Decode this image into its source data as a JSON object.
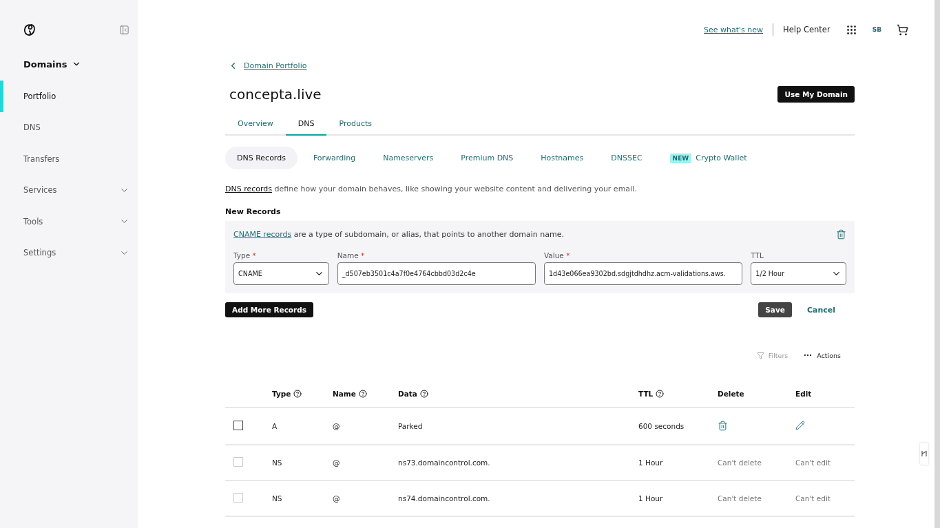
{
  "sidebar": {
    "section": "Domains",
    "items": [
      {
        "label": "Portfolio",
        "selected": true,
        "expandable": false
      },
      {
        "label": "DNS",
        "selected": false,
        "expandable": false
      },
      {
        "label": "Transfers",
        "selected": false,
        "expandable": false
      },
      {
        "label": "Services",
        "selected": false,
        "expandable": true
      },
      {
        "label": "Tools",
        "selected": false,
        "expandable": true
      },
      {
        "label": "Settings",
        "selected": false,
        "expandable": true
      }
    ]
  },
  "header": {
    "whats_new": "See what's new",
    "help": "Help Center",
    "avatar": "SB"
  },
  "breadcrumb": "Domain Portfolio",
  "title": "concepta.live",
  "primary_button": "Use My Domain",
  "tabs": [
    {
      "label": "Overview",
      "selected": false
    },
    {
      "label": "DNS",
      "selected": true
    },
    {
      "label": "Products",
      "selected": false
    }
  ],
  "subtabs": [
    {
      "label": "DNS Records",
      "selected": true
    },
    {
      "label": "Forwarding",
      "selected": false
    },
    {
      "label": "Nameservers",
      "selected": false
    },
    {
      "label": "Premium DNS",
      "selected": false
    },
    {
      "label": "Hostnames",
      "selected": false
    },
    {
      "label": "DNSSEC",
      "selected": false
    },
    {
      "label": "Crypto Wallet",
      "selected": false,
      "badge": "NEW"
    }
  ],
  "description": {
    "link": "DNS records",
    "text": " define how your domain behaves, like showing your website content and delivering your email."
  },
  "new_records": {
    "heading": "New Records",
    "hint_link": "CNAME records",
    "hint": " are a type of subdomain, or alias, that points to another domain name.",
    "fields": [
      {
        "kind": "select",
        "label": "Type",
        "required_mark": "*",
        "value": "CNAME"
      },
      {
        "kind": "text",
        "label": "Name",
        "required_mark": "*",
        "value": "_d507eb3501c4a7f0e4764cbbd03d2c4e"
      },
      {
        "kind": "text",
        "label": "Value",
        "required_mark": "*",
        "value": "1d43e066ea9302bd.sdgjtdhdhz.acm-validations.aws."
      },
      {
        "kind": "select",
        "label": "TTL",
        "value": "1/2 Hour"
      }
    ],
    "add_button": "Add More Records",
    "save_button": "Save",
    "cancel_button": "Cancel"
  },
  "toolbar": {
    "filters": "Filters",
    "actions": "Actions"
  },
  "table": {
    "columns": [
      {
        "label": "Type",
        "help": true
      },
      {
        "label": "Name",
        "help": true
      },
      {
        "label": "Data",
        "help": true
      },
      {
        "label": "TTL",
        "help": true
      },
      {
        "label": "Delete",
        "help": false
      },
      {
        "label": "Edit",
        "help": false
      }
    ],
    "rows": [
      {
        "kind": "editable",
        "checked": false,
        "disabled": false,
        "type": "A",
        "name": "@",
        "data": "Parked",
        "ttl": "600 seconds"
      },
      {
        "kind": "locked",
        "checked": false,
        "disabled": true,
        "type": "NS",
        "name": "@",
        "data": "ns73.domaincontrol.com.",
        "ttl": "1 Hour",
        "delete": "Can't delete",
        "edit": "Can't edit"
      },
      {
        "kind": "locked",
        "checked": false,
        "disabled": true,
        "type": "NS",
        "name": "@",
        "data": "ns74.domaincontrol.com.",
        "ttl": "1 Hour",
        "delete": "Can't delete",
        "edit": "Can't edit"
      }
    ]
  }
}
